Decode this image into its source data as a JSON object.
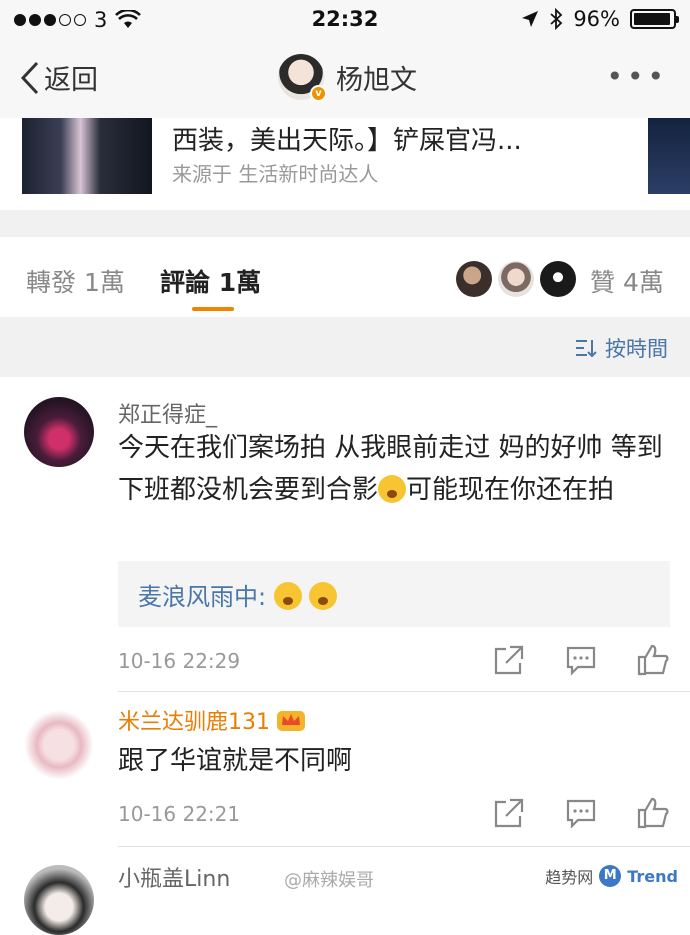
{
  "status_bar": {
    "carrier": "3",
    "time": "22:32",
    "battery": "96%",
    "battery_level": 0.96
  },
  "nav": {
    "back_label": "返回",
    "title": "杨旭文"
  },
  "shared_card": {
    "title": "西装，美出天际。】铲屎官冯...",
    "source": "来源于 生活新时尚达人"
  },
  "tabs": {
    "repost": "轉發 1萬",
    "comment": "評論 1萬",
    "like": "贊 4萬"
  },
  "sort_label": "按時間",
  "comments": [
    {
      "username": "郑正得症_",
      "text_before": "今天在我们案场拍 从我眼前走过 妈的好帅 等到下班都没机会要到合影",
      "text_after": "可能现在你还在拍",
      "reply": "麦浪风雨中:",
      "time": "10-16 22:29"
    },
    {
      "username": "米兰达驯鹿131",
      "text": "跟了华谊就是不同啊",
      "time": "10-16 22:21"
    },
    {
      "username": "小瓶盖Linn"
    }
  ],
  "watermark": "@麻辣娱哥",
  "brand": {
    "cn": "趋势网",
    "en": "Trend"
  },
  "colors": {
    "accent": "#f08300",
    "link": "#4a76a8",
    "vip": "#e87e04"
  }
}
